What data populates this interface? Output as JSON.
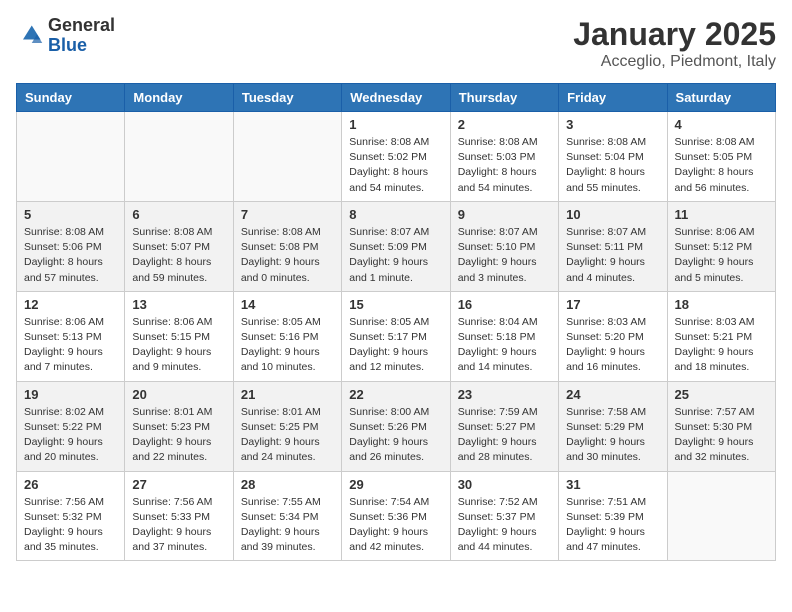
{
  "header": {
    "logo_general": "General",
    "logo_blue": "Blue",
    "month": "January 2025",
    "location": "Acceglio, Piedmont, Italy"
  },
  "weekdays": [
    "Sunday",
    "Monday",
    "Tuesday",
    "Wednesday",
    "Thursday",
    "Friday",
    "Saturday"
  ],
  "weeks": [
    {
      "shaded": false,
      "days": [
        {
          "num": "",
          "text": ""
        },
        {
          "num": "",
          "text": ""
        },
        {
          "num": "",
          "text": ""
        },
        {
          "num": "1",
          "text": "Sunrise: 8:08 AM\nSunset: 5:02 PM\nDaylight: 8 hours\nand 54 minutes."
        },
        {
          "num": "2",
          "text": "Sunrise: 8:08 AM\nSunset: 5:03 PM\nDaylight: 8 hours\nand 54 minutes."
        },
        {
          "num": "3",
          "text": "Sunrise: 8:08 AM\nSunset: 5:04 PM\nDaylight: 8 hours\nand 55 minutes."
        },
        {
          "num": "4",
          "text": "Sunrise: 8:08 AM\nSunset: 5:05 PM\nDaylight: 8 hours\nand 56 minutes."
        }
      ]
    },
    {
      "shaded": true,
      "days": [
        {
          "num": "5",
          "text": "Sunrise: 8:08 AM\nSunset: 5:06 PM\nDaylight: 8 hours\nand 57 minutes."
        },
        {
          "num": "6",
          "text": "Sunrise: 8:08 AM\nSunset: 5:07 PM\nDaylight: 8 hours\nand 59 minutes."
        },
        {
          "num": "7",
          "text": "Sunrise: 8:08 AM\nSunset: 5:08 PM\nDaylight: 9 hours\nand 0 minutes."
        },
        {
          "num": "8",
          "text": "Sunrise: 8:07 AM\nSunset: 5:09 PM\nDaylight: 9 hours\nand 1 minute."
        },
        {
          "num": "9",
          "text": "Sunrise: 8:07 AM\nSunset: 5:10 PM\nDaylight: 9 hours\nand 3 minutes."
        },
        {
          "num": "10",
          "text": "Sunrise: 8:07 AM\nSunset: 5:11 PM\nDaylight: 9 hours\nand 4 minutes."
        },
        {
          "num": "11",
          "text": "Sunrise: 8:06 AM\nSunset: 5:12 PM\nDaylight: 9 hours\nand 5 minutes."
        }
      ]
    },
    {
      "shaded": false,
      "days": [
        {
          "num": "12",
          "text": "Sunrise: 8:06 AM\nSunset: 5:13 PM\nDaylight: 9 hours\nand 7 minutes."
        },
        {
          "num": "13",
          "text": "Sunrise: 8:06 AM\nSunset: 5:15 PM\nDaylight: 9 hours\nand 9 minutes."
        },
        {
          "num": "14",
          "text": "Sunrise: 8:05 AM\nSunset: 5:16 PM\nDaylight: 9 hours\nand 10 minutes."
        },
        {
          "num": "15",
          "text": "Sunrise: 8:05 AM\nSunset: 5:17 PM\nDaylight: 9 hours\nand 12 minutes."
        },
        {
          "num": "16",
          "text": "Sunrise: 8:04 AM\nSunset: 5:18 PM\nDaylight: 9 hours\nand 14 minutes."
        },
        {
          "num": "17",
          "text": "Sunrise: 8:03 AM\nSunset: 5:20 PM\nDaylight: 9 hours\nand 16 minutes."
        },
        {
          "num": "18",
          "text": "Sunrise: 8:03 AM\nSunset: 5:21 PM\nDaylight: 9 hours\nand 18 minutes."
        }
      ]
    },
    {
      "shaded": true,
      "days": [
        {
          "num": "19",
          "text": "Sunrise: 8:02 AM\nSunset: 5:22 PM\nDaylight: 9 hours\nand 20 minutes."
        },
        {
          "num": "20",
          "text": "Sunrise: 8:01 AM\nSunset: 5:23 PM\nDaylight: 9 hours\nand 22 minutes."
        },
        {
          "num": "21",
          "text": "Sunrise: 8:01 AM\nSunset: 5:25 PM\nDaylight: 9 hours\nand 24 minutes."
        },
        {
          "num": "22",
          "text": "Sunrise: 8:00 AM\nSunset: 5:26 PM\nDaylight: 9 hours\nand 26 minutes."
        },
        {
          "num": "23",
          "text": "Sunrise: 7:59 AM\nSunset: 5:27 PM\nDaylight: 9 hours\nand 28 minutes."
        },
        {
          "num": "24",
          "text": "Sunrise: 7:58 AM\nSunset: 5:29 PM\nDaylight: 9 hours\nand 30 minutes."
        },
        {
          "num": "25",
          "text": "Sunrise: 7:57 AM\nSunset: 5:30 PM\nDaylight: 9 hours\nand 32 minutes."
        }
      ]
    },
    {
      "shaded": false,
      "days": [
        {
          "num": "26",
          "text": "Sunrise: 7:56 AM\nSunset: 5:32 PM\nDaylight: 9 hours\nand 35 minutes."
        },
        {
          "num": "27",
          "text": "Sunrise: 7:56 AM\nSunset: 5:33 PM\nDaylight: 9 hours\nand 37 minutes."
        },
        {
          "num": "28",
          "text": "Sunrise: 7:55 AM\nSunset: 5:34 PM\nDaylight: 9 hours\nand 39 minutes."
        },
        {
          "num": "29",
          "text": "Sunrise: 7:54 AM\nSunset: 5:36 PM\nDaylight: 9 hours\nand 42 minutes."
        },
        {
          "num": "30",
          "text": "Sunrise: 7:52 AM\nSunset: 5:37 PM\nDaylight: 9 hours\nand 44 minutes."
        },
        {
          "num": "31",
          "text": "Sunrise: 7:51 AM\nSunset: 5:39 PM\nDaylight: 9 hours\nand 47 minutes."
        },
        {
          "num": "",
          "text": ""
        }
      ]
    }
  ]
}
